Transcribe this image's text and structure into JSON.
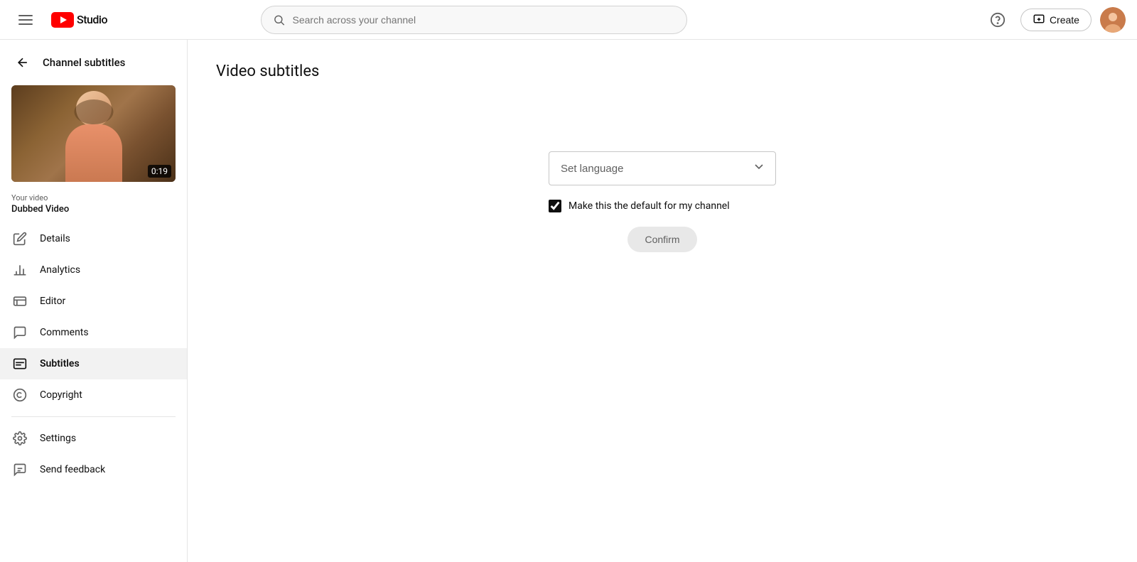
{
  "topnav": {
    "search_placeholder": "Search across your channel",
    "create_label": "Create",
    "help_icon": "question-circle-icon",
    "menu_icon": "hamburger-icon"
  },
  "sidebar": {
    "back_label": "Channel subtitles",
    "video": {
      "duration": "0:19",
      "your_video_label": "Your video",
      "video_name": "Dubbed Video"
    },
    "nav_items": [
      {
        "id": "details",
        "label": "Details",
        "icon": "pencil-icon"
      },
      {
        "id": "analytics",
        "label": "Analytics",
        "icon": "analytics-icon"
      },
      {
        "id": "editor",
        "label": "Editor",
        "icon": "editor-icon"
      },
      {
        "id": "comments",
        "label": "Comments",
        "icon": "comments-icon"
      },
      {
        "id": "subtitles",
        "label": "Subtitles",
        "icon": "subtitles-icon",
        "active": true
      },
      {
        "id": "copyright",
        "label": "Copyright",
        "icon": "copyright-icon"
      }
    ],
    "bottom_items": [
      {
        "id": "settings",
        "label": "Settings",
        "icon": "gear-icon"
      },
      {
        "id": "send-feedback",
        "label": "Send feedback",
        "icon": "feedback-icon"
      }
    ]
  },
  "main": {
    "page_title": "Video subtitles",
    "language_placeholder": "Set language",
    "checkbox_label": "Make this the default for my channel",
    "checkbox_checked": true,
    "confirm_label": "Confirm"
  }
}
